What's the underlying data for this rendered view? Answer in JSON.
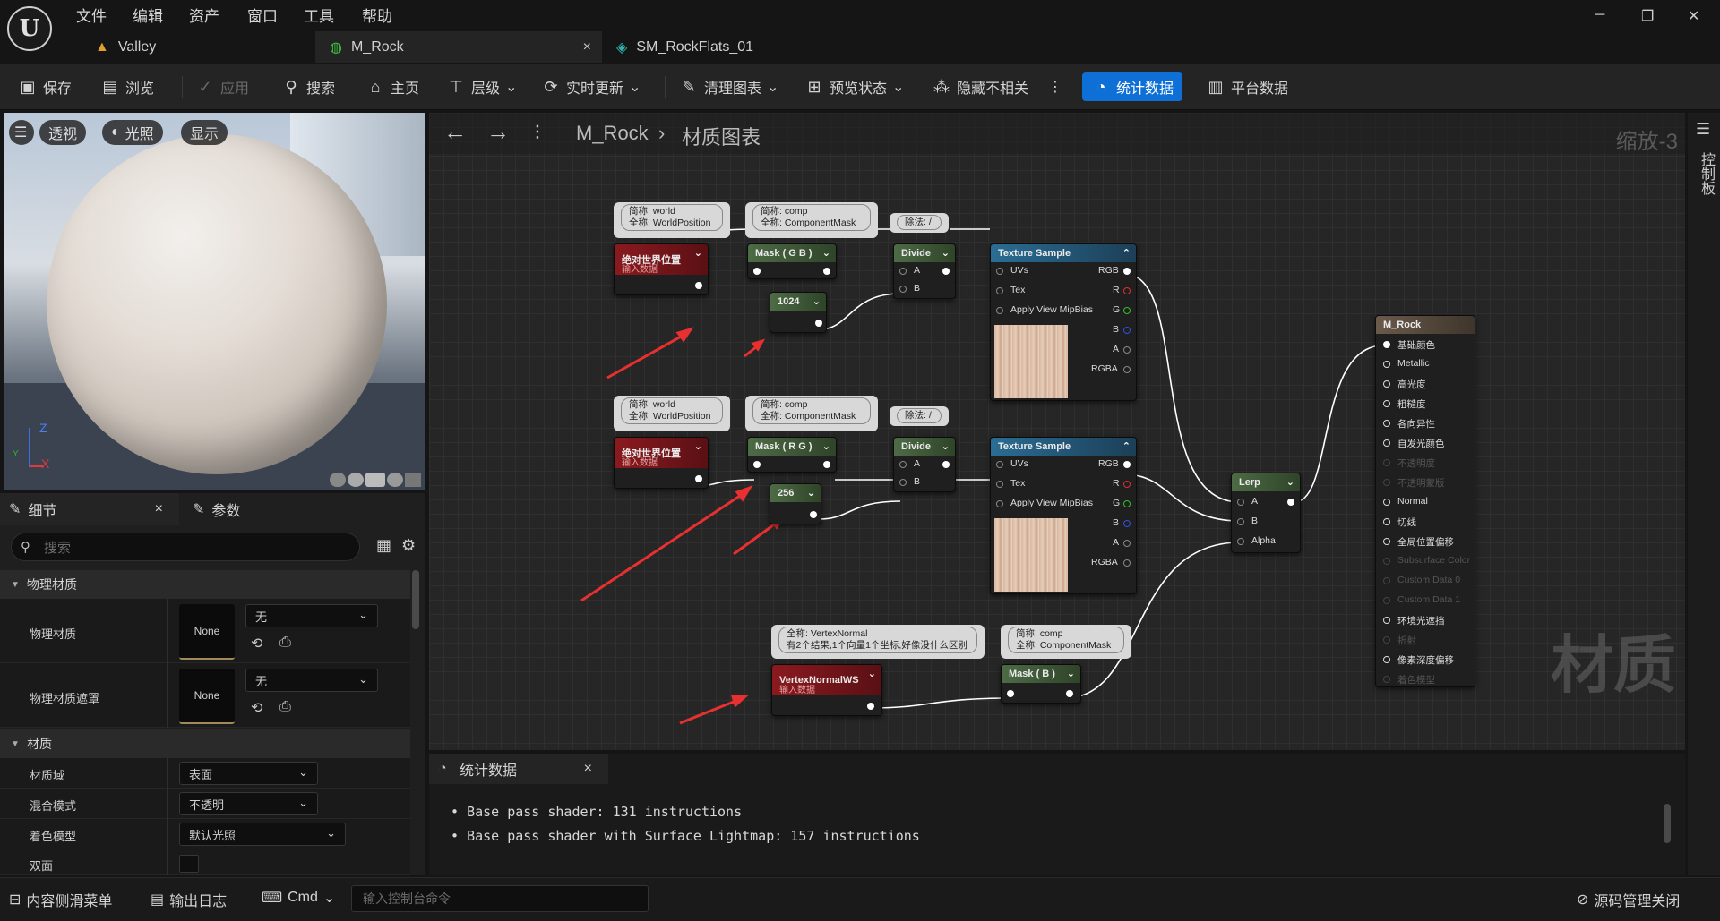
{
  "app": {
    "logo": "U",
    "menu": [
      "文件",
      "编辑",
      "资产",
      "窗口",
      "工具",
      "帮助"
    ],
    "window_buttons": [
      "minimize-icon",
      "restore-icon",
      "close-icon"
    ]
  },
  "tabs": [
    {
      "label": "Valley",
      "icon": "level-icon"
    },
    {
      "label": "M_Rock",
      "icon": "material-icon",
      "active": true,
      "close": "×"
    },
    {
      "label": "SM_RockFlats_01",
      "icon": "static-mesh-icon"
    }
  ],
  "toolbar": {
    "save": "保存",
    "browse": "浏览",
    "apply": "应用",
    "search": "搜索",
    "home": "主页",
    "hierarchy": "层级",
    "live_update": "实时更新",
    "clean_graph": "清理图表",
    "preview_state": "预览状态",
    "hide_unrelated": "隐藏不相关",
    "stats": "统计数据",
    "platform_stats": "平台数据"
  },
  "viewport": {
    "menu_icon": "hamburger-icon",
    "perspective": "透视",
    "lighting": "光照",
    "show": "显示",
    "axis_z": "Z",
    "axis_x": "X",
    "axis_y": "Y"
  },
  "details": {
    "tab_details": "细节",
    "tab_params": "参数",
    "close": "×",
    "search_placeholder": "搜索",
    "sections": {
      "physical_material": "物理材质",
      "material": "材质"
    },
    "props": {
      "phys_mat_label": "物理材质",
      "phys_mat_thumb": "None",
      "phys_mat_value": "无",
      "phys_mask_label": "物理材质遮罩",
      "phys_mask_thumb": "None",
      "phys_mask_value": "无",
      "domain_label": "材质域",
      "domain_value": "表面",
      "blend_label": "混合模式",
      "blend_value": "不透明",
      "shading_label": "着色模型",
      "shading_value": "默认光照",
      "twosided_label": "双面"
    }
  },
  "graph": {
    "breadcrumb_root": "M_Rock",
    "breadcrumb_child": "材质图表",
    "zoom": "缩放-3",
    "watermark": "材质",
    "comments": {
      "c1": [
        "简称: world",
        "全称: WorldPosition"
      ],
      "c2": [
        "简称: comp",
        "全称: ComponentMask"
      ],
      "c3": "除法: /",
      "c4": [
        "简称: world",
        "全称: WorldPosition"
      ],
      "c5": [
        "简称: comp",
        "全称: ComponentMask"
      ],
      "c6": "除法: /",
      "c7": [
        "全称: VertexNormal",
        "有2个结果,1个向量1个坐标,好像没什么区别"
      ],
      "c8": [
        "简称: comp",
        "全称: ComponentMask"
      ]
    },
    "nodes": {
      "abs_world_pos": "绝对世界位置",
      "input_data": "输入数据",
      "mask_gb": "Mask ( G B )",
      "mask_rg": "Mask ( R G )",
      "mask_b": "Mask ( B )",
      "const_1024": "1024",
      "const_256": "256",
      "divide": "Divide",
      "pin_a": "A",
      "pin_b": "B",
      "tex_sample": "Texture Sample",
      "tex_pins_left": [
        "UVs",
        "Tex",
        "Apply View MipBias"
      ],
      "tex_pins_right": [
        "RGB",
        "R",
        "G",
        "B",
        "A",
        "RGBA"
      ],
      "vertex_normal": "VertexNormalWS",
      "lerp": "Lerp",
      "lerp_alpha": "Alpha",
      "result": "M_Rock",
      "result_pins": [
        "基础颜色",
        "Metallic",
        "高光度",
        "粗糙度",
        "各向异性",
        "自发光颜色",
        "不透明度",
        "不透明蒙版",
        "Normal",
        "切线",
        "全局位置偏移",
        "Subsurface Color",
        "Custom Data 0",
        "Custom Data 1",
        "环境光遮挡",
        "折射",
        "像素深度偏移",
        "着色模型"
      ]
    },
    "pin_colors": {
      "R": "#e03030",
      "G": "#30c030",
      "B": "#3050e0",
      "A": "#bbbbbb"
    }
  },
  "stats": {
    "tab": "统计数据",
    "close": "×",
    "lines": [
      "Base pass shader: 131 instructions",
      "Base pass shader with Surface Lightmap: 157 instructions"
    ]
  },
  "right_strip": {
    "label": "控制板"
  },
  "statusbar": {
    "content_drawer": "内容侧滑菜单",
    "output_log": "输出日志",
    "cmd": "Cmd",
    "console_placeholder": "输入控制台命令",
    "source_control": "源码管理关闭"
  }
}
